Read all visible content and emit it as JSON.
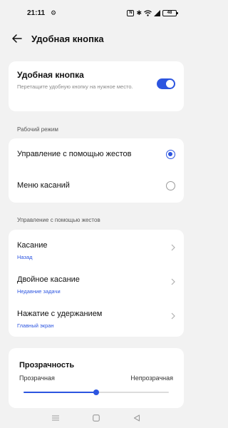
{
  "status_bar": {
    "time": "21:11",
    "settings_icon": "gear-icon",
    "icons": [
      "nfc-icon",
      "bluetooth-icon",
      "wifi-icon",
      "signal-icon",
      "battery-icon"
    ],
    "battery": "48"
  },
  "app_bar": {
    "back_icon": "arrow-left-icon",
    "title": "Удобная кнопка"
  },
  "main_toggle": {
    "title": "Удобная кнопка",
    "description": "Перетащите удобную кнопку на нужное место.",
    "enabled": true
  },
  "mode_section": {
    "label": "Рабочий режим",
    "options": [
      {
        "label": "Управление с помощью жестов",
        "selected": true
      },
      {
        "label": "Меню касаний",
        "selected": false
      }
    ]
  },
  "gestures_section": {
    "label": "Управление с помощью жестов",
    "items": [
      {
        "title": "Касание",
        "value": "Назад"
      },
      {
        "title": "Двойное касание",
        "value": "Недавние задачи"
      },
      {
        "title": "Нажатие с удержанием",
        "value": "Главный экран"
      }
    ]
  },
  "transparency": {
    "title": "Прозрачность",
    "min_label": "Прозрачная",
    "max_label": "Непрозрачная",
    "value_fraction": 0.5
  },
  "colors": {
    "accent": "#2c55e0",
    "background": "#f2f2f2",
    "card": "#ffffff",
    "secondary_text": "#8a8a8a"
  },
  "nav_bar": {
    "icons": [
      "menu-icon",
      "home-icon",
      "back-icon"
    ]
  }
}
